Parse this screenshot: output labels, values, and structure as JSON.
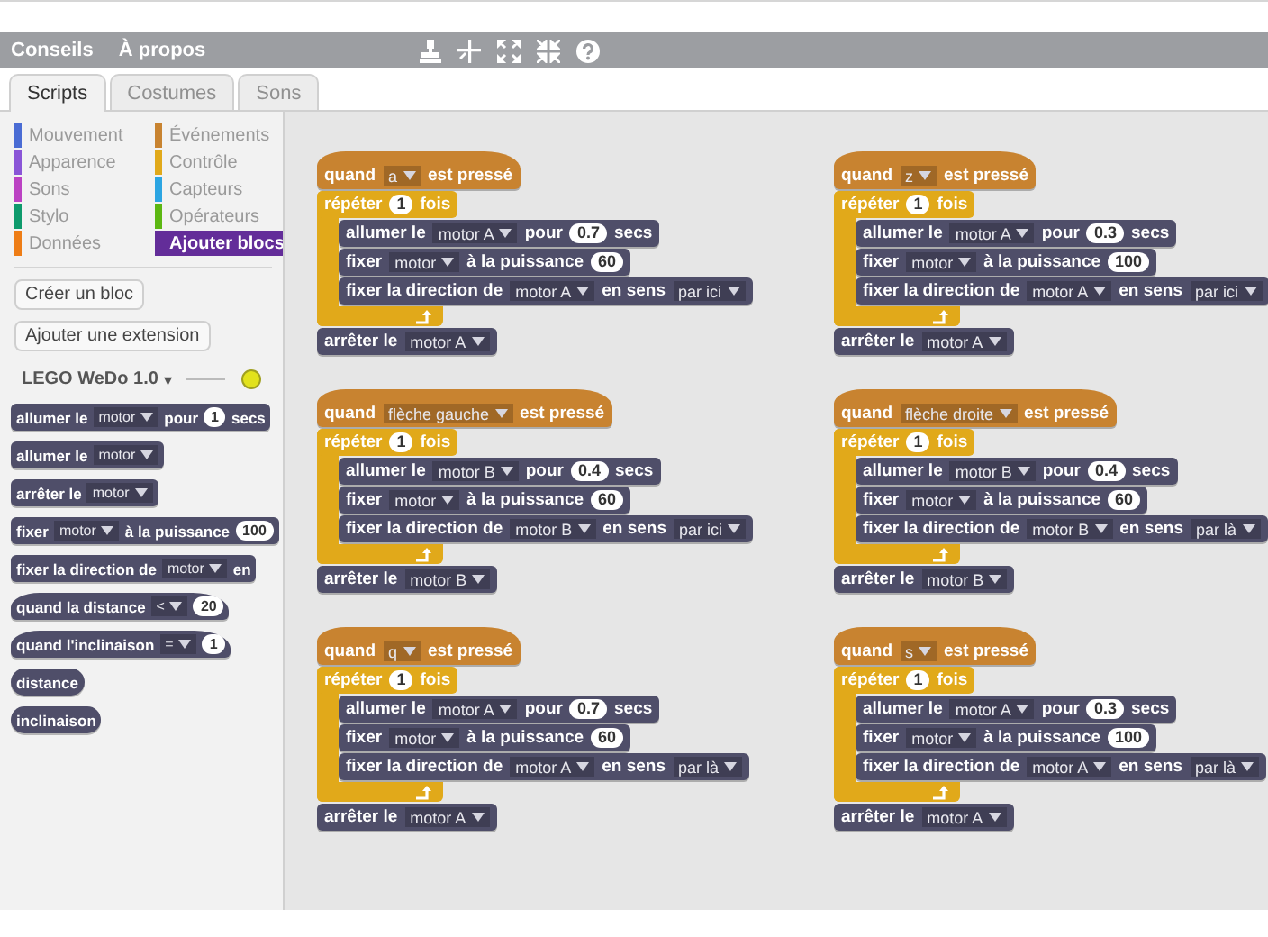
{
  "menu_bar": {
    "items": [
      "Conseils",
      "À propos"
    ]
  },
  "tabs": [
    {
      "label": "Scripts",
      "selected": true
    },
    {
      "label": "Costumes",
      "selected": false
    },
    {
      "label": "Sons",
      "selected": false
    }
  ],
  "palette": {
    "categories": [
      {
        "label": "Mouvement",
        "color": "#4a6cd4",
        "selected": false
      },
      {
        "label": "Événements",
        "color": "#c88330",
        "selected": false
      },
      {
        "label": "Apparence",
        "color": "#8a55d7",
        "selected": false
      },
      {
        "label": "Contrôle",
        "color": "#e1a91a",
        "selected": false
      },
      {
        "label": "Sons",
        "color": "#bb42c3",
        "selected": false
      },
      {
        "label": "Capteurs",
        "color": "#2ca5e2",
        "selected": false
      },
      {
        "label": "Stylo",
        "color": "#0e9a6c",
        "selected": false
      },
      {
        "label": "Opérateurs",
        "color": "#5cb712",
        "selected": false
      },
      {
        "label": "Données",
        "color": "#ee7d16",
        "selected": false
      },
      {
        "label": "Ajouter blocs",
        "color": "#632d99",
        "selected": true
      }
    ],
    "buttons": [
      "Créer un bloc",
      "Ajouter une extension"
    ],
    "extension": {
      "name": "LEGO WeDo 1.0",
      "menu_glyph": "▾",
      "ready": false
    },
    "blocks": [
      {
        "kind": "command",
        "color": "#4f4e69",
        "parts": [
          {
            "kind": "label",
            "text": "allumer le"
          },
          {
            "kind": "dropdown",
            "text": "motor"
          },
          {
            "kind": "label",
            "text": "pour"
          },
          {
            "kind": "number",
            "text": "1"
          },
          {
            "kind": "label",
            "text": "secs"
          }
        ]
      },
      {
        "kind": "command",
        "color": "#4f4e69",
        "parts": [
          {
            "kind": "label",
            "text": "allumer le"
          },
          {
            "kind": "dropdown",
            "text": "motor"
          }
        ]
      },
      {
        "kind": "command",
        "color": "#4f4e69",
        "parts": [
          {
            "kind": "label",
            "text": "arrêter le"
          },
          {
            "kind": "dropdown",
            "text": "motor"
          }
        ]
      },
      {
        "kind": "command",
        "color": "#4f4e69",
        "parts": [
          {
            "kind": "label",
            "text": "fixer"
          },
          {
            "kind": "dropdown",
            "text": "motor"
          },
          {
            "kind": "label",
            "text": "à la puissance"
          },
          {
            "kind": "number",
            "text": "100"
          }
        ]
      },
      {
        "kind": "command",
        "color": "#4f4e69",
        "parts": [
          {
            "kind": "label",
            "text": "fixer la direction de"
          },
          {
            "kind": "dropdown",
            "text": "motor"
          },
          {
            "kind": "label",
            "text": "en"
          }
        ]
      },
      {
        "kind": "hat",
        "color": "#4f4e69",
        "parts": [
          {
            "kind": "label",
            "text": "quand la distance"
          },
          {
            "kind": "dropdown",
            "text": "<"
          },
          {
            "kind": "number",
            "text": "20"
          }
        ]
      },
      {
        "kind": "hat",
        "color": "#4f4e69",
        "parts": [
          {
            "kind": "label",
            "text": "quand l'inclinaison"
          },
          {
            "kind": "dropdown",
            "text": "="
          },
          {
            "kind": "number",
            "text": "1"
          }
        ]
      },
      {
        "kind": "reporter",
        "color": "#4f4e69",
        "parts": [
          {
            "kind": "label",
            "text": "distance"
          }
        ]
      },
      {
        "kind": "reporter",
        "color": "#4f4e69",
        "parts": [
          {
            "kind": "label",
            "text": "inclinaison"
          }
        ]
      }
    ]
  },
  "scripts": [
    {
      "blocks": [
        {
          "kind": "hat",
          "color": "#c88330",
          "parts": [
            {
              "kind": "label",
              "text": "quand"
            },
            {
              "kind": "dropdown",
              "text": "a"
            },
            {
              "kind": "label",
              "text": "est pressé"
            }
          ]
        },
        {
          "kind": "repeat",
          "color": "#e1a91a",
          "parts": [
            {
              "kind": "label",
              "text": "répéter"
            },
            {
              "kind": "number",
              "text": "1"
            },
            {
              "kind": "label",
              "text": "fois"
            }
          ],
          "children": [
            {
              "kind": "command",
              "color": "#4f4e69",
              "parts": [
                {
                  "kind": "label",
                  "text": "allumer le"
                },
                {
                  "kind": "dropdown",
                  "text": "motor A"
                },
                {
                  "kind": "label",
                  "text": "pour"
                },
                {
                  "kind": "number",
                  "text": "0.7"
                },
                {
                  "kind": "label",
                  "text": "secs"
                }
              ]
            },
            {
              "kind": "command",
              "color": "#4f4e69",
              "parts": [
                {
                  "kind": "label",
                  "text": "fixer"
                },
                {
                  "kind": "dropdown",
                  "text": "motor"
                },
                {
                  "kind": "label",
                  "text": "à la puissance"
                },
                {
                  "kind": "number",
                  "text": "60"
                }
              ]
            },
            {
              "kind": "command",
              "color": "#4f4e69",
              "parts": [
                {
                  "kind": "label",
                  "text": "fixer la direction de"
                },
                {
                  "kind": "dropdown",
                  "text": "motor A"
                },
                {
                  "kind": "label",
                  "text": "en sens"
                },
                {
                  "kind": "dropdown",
                  "text": "par ici"
                }
              ]
            }
          ]
        },
        {
          "kind": "command",
          "color": "#4f4e69",
          "parts": [
            {
              "kind": "label",
              "text": "arrêter le"
            },
            {
              "kind": "dropdown",
              "text": "motor A"
            }
          ]
        }
      ]
    },
    {
      "blocks": [
        {
          "kind": "hat",
          "color": "#c88330",
          "parts": [
            {
              "kind": "label",
              "text": "quand"
            },
            {
              "kind": "dropdown",
              "text": "z"
            },
            {
              "kind": "label",
              "text": "est pressé"
            }
          ]
        },
        {
          "kind": "repeat",
          "color": "#e1a91a",
          "parts": [
            {
              "kind": "label",
              "text": "répéter"
            },
            {
              "kind": "number",
              "text": "1"
            },
            {
              "kind": "label",
              "text": "fois"
            }
          ],
          "children": [
            {
              "kind": "command",
              "color": "#4f4e69",
              "parts": [
                {
                  "kind": "label",
                  "text": "allumer le"
                },
                {
                  "kind": "dropdown",
                  "text": "motor A"
                },
                {
                  "kind": "label",
                  "text": "pour"
                },
                {
                  "kind": "number",
                  "text": "0.3"
                },
                {
                  "kind": "label",
                  "text": "secs"
                }
              ]
            },
            {
              "kind": "command",
              "color": "#4f4e69",
              "parts": [
                {
                  "kind": "label",
                  "text": "fixer"
                },
                {
                  "kind": "dropdown",
                  "text": "motor"
                },
                {
                  "kind": "label",
                  "text": "à la puissance"
                },
                {
                  "kind": "number",
                  "text": "100"
                }
              ]
            },
            {
              "kind": "command",
              "color": "#4f4e69",
              "parts": [
                {
                  "kind": "label",
                  "text": "fixer la direction de"
                },
                {
                  "kind": "dropdown",
                  "text": "motor A"
                },
                {
                  "kind": "label",
                  "text": "en sens"
                },
                {
                  "kind": "dropdown",
                  "text": "par ici"
                }
              ]
            }
          ]
        },
        {
          "kind": "command",
          "color": "#4f4e69",
          "parts": [
            {
              "kind": "label",
              "text": "arrêter le"
            },
            {
              "kind": "dropdown",
              "text": "motor A"
            }
          ]
        }
      ]
    },
    {
      "blocks": [
        {
          "kind": "hat",
          "color": "#c88330",
          "parts": [
            {
              "kind": "label",
              "text": "quand"
            },
            {
              "kind": "dropdown",
              "text": "flèche gauche"
            },
            {
              "kind": "label",
              "text": "est pressé"
            }
          ]
        },
        {
          "kind": "repeat",
          "color": "#e1a91a",
          "parts": [
            {
              "kind": "label",
              "text": "répéter"
            },
            {
              "kind": "number",
              "text": "1"
            },
            {
              "kind": "label",
              "text": "fois"
            }
          ],
          "children": [
            {
              "kind": "command",
              "color": "#4f4e69",
              "parts": [
                {
                  "kind": "label",
                  "text": "allumer le"
                },
                {
                  "kind": "dropdown",
                  "text": "motor B"
                },
                {
                  "kind": "label",
                  "text": "pour"
                },
                {
                  "kind": "number",
                  "text": "0.4"
                },
                {
                  "kind": "label",
                  "text": "secs"
                }
              ]
            },
            {
              "kind": "command",
              "color": "#4f4e69",
              "parts": [
                {
                  "kind": "label",
                  "text": "fixer"
                },
                {
                  "kind": "dropdown",
                  "text": "motor"
                },
                {
                  "kind": "label",
                  "text": "à la puissance"
                },
                {
                  "kind": "number",
                  "text": "60"
                }
              ]
            },
            {
              "kind": "command",
              "color": "#4f4e69",
              "parts": [
                {
                  "kind": "label",
                  "text": "fixer la direction de"
                },
                {
                  "kind": "dropdown",
                  "text": "motor B"
                },
                {
                  "kind": "label",
                  "text": "en sens"
                },
                {
                  "kind": "dropdown",
                  "text": "par ici"
                }
              ]
            }
          ]
        },
        {
          "kind": "command",
          "color": "#4f4e69",
          "parts": [
            {
              "kind": "label",
              "text": "arrêter le"
            },
            {
              "kind": "dropdown",
              "text": "motor B"
            }
          ]
        }
      ]
    },
    {
      "blocks": [
        {
          "kind": "hat",
          "color": "#c88330",
          "parts": [
            {
              "kind": "label",
              "text": "quand"
            },
            {
              "kind": "dropdown",
              "text": "flèche droite"
            },
            {
              "kind": "label",
              "text": "est pressé"
            }
          ]
        },
        {
          "kind": "repeat",
          "color": "#e1a91a",
          "parts": [
            {
              "kind": "label",
              "text": "répéter"
            },
            {
              "kind": "number",
              "text": "1"
            },
            {
              "kind": "label",
              "text": "fois"
            }
          ],
          "children": [
            {
              "kind": "command",
              "color": "#4f4e69",
              "parts": [
                {
                  "kind": "label",
                  "text": "allumer le"
                },
                {
                  "kind": "dropdown",
                  "text": "motor B"
                },
                {
                  "kind": "label",
                  "text": "pour"
                },
                {
                  "kind": "number",
                  "text": "0.4"
                },
                {
                  "kind": "label",
                  "text": "secs"
                }
              ]
            },
            {
              "kind": "command",
              "color": "#4f4e69",
              "parts": [
                {
                  "kind": "label",
                  "text": "fixer"
                },
                {
                  "kind": "dropdown",
                  "text": "motor"
                },
                {
                  "kind": "label",
                  "text": "à la puissance"
                },
                {
                  "kind": "number",
                  "text": "60"
                }
              ]
            },
            {
              "kind": "command",
              "color": "#4f4e69",
              "parts": [
                {
                  "kind": "label",
                  "text": "fixer la direction de"
                },
                {
                  "kind": "dropdown",
                  "text": "motor B"
                },
                {
                  "kind": "label",
                  "text": "en sens"
                },
                {
                  "kind": "dropdown",
                  "text": "par là"
                }
              ]
            }
          ]
        },
        {
          "kind": "command",
          "color": "#4f4e69",
          "parts": [
            {
              "kind": "label",
              "text": "arrêter le"
            },
            {
              "kind": "dropdown",
              "text": "motor B"
            }
          ]
        }
      ]
    },
    {
      "blocks": [
        {
          "kind": "hat",
          "color": "#c88330",
          "parts": [
            {
              "kind": "label",
              "text": "quand"
            },
            {
              "kind": "dropdown",
              "text": "q"
            },
            {
              "kind": "label",
              "text": "est pressé"
            }
          ]
        },
        {
          "kind": "repeat",
          "color": "#e1a91a",
          "parts": [
            {
              "kind": "label",
              "text": "répéter"
            },
            {
              "kind": "number",
              "text": "1"
            },
            {
              "kind": "label",
              "text": "fois"
            }
          ],
          "children": [
            {
              "kind": "command",
              "color": "#4f4e69",
              "parts": [
                {
                  "kind": "label",
                  "text": "allumer le"
                },
                {
                  "kind": "dropdown",
                  "text": "motor A"
                },
                {
                  "kind": "label",
                  "text": "pour"
                },
                {
                  "kind": "number",
                  "text": "0.7"
                },
                {
                  "kind": "label",
                  "text": "secs"
                }
              ]
            },
            {
              "kind": "command",
              "color": "#4f4e69",
              "parts": [
                {
                  "kind": "label",
                  "text": "fixer"
                },
                {
                  "kind": "dropdown",
                  "text": "motor"
                },
                {
                  "kind": "label",
                  "text": "à la puissance"
                },
                {
                  "kind": "number",
                  "text": "60"
                }
              ]
            },
            {
              "kind": "command",
              "color": "#4f4e69",
              "parts": [
                {
                  "kind": "label",
                  "text": "fixer la direction de"
                },
                {
                  "kind": "dropdown",
                  "text": "motor A"
                },
                {
                  "kind": "label",
                  "text": "en sens"
                },
                {
                  "kind": "dropdown",
                  "text": "par là"
                }
              ]
            }
          ]
        },
        {
          "kind": "command",
          "color": "#4f4e69",
          "parts": [
            {
              "kind": "label",
              "text": "arrêter le"
            },
            {
              "kind": "dropdown",
              "text": "motor A"
            }
          ]
        }
      ]
    },
    {
      "blocks": [
        {
          "kind": "hat",
          "color": "#c88330",
          "parts": [
            {
              "kind": "label",
              "text": "quand"
            },
            {
              "kind": "dropdown",
              "text": "s"
            },
            {
              "kind": "label",
              "text": "est pressé"
            }
          ]
        },
        {
          "kind": "repeat",
          "color": "#e1a91a",
          "parts": [
            {
              "kind": "label",
              "text": "répéter"
            },
            {
              "kind": "number",
              "text": "1"
            },
            {
              "kind": "label",
              "text": "fois"
            }
          ],
          "children": [
            {
              "kind": "command",
              "color": "#4f4e69",
              "parts": [
                {
                  "kind": "label",
                  "text": "allumer le"
                },
                {
                  "kind": "dropdown",
                  "text": "motor A"
                },
                {
                  "kind": "label",
                  "text": "pour"
                },
                {
                  "kind": "number",
                  "text": "0.3"
                },
                {
                  "kind": "label",
                  "text": "secs"
                }
              ]
            },
            {
              "kind": "command",
              "color": "#4f4e69",
              "parts": [
                {
                  "kind": "label",
                  "text": "fixer"
                },
                {
                  "kind": "dropdown",
                  "text": "motor"
                },
                {
                  "kind": "label",
                  "text": "à la puissance"
                },
                {
                  "kind": "number",
                  "text": "100"
                }
              ]
            },
            {
              "kind": "command",
              "color": "#4f4e69",
              "parts": [
                {
                  "kind": "label",
                  "text": "fixer la direction de"
                },
                {
                  "kind": "dropdown",
                  "text": "motor A"
                },
                {
                  "kind": "label",
                  "text": "en sens"
                },
                {
                  "kind": "dropdown",
                  "text": "par là"
                }
              ]
            }
          ]
        },
        {
          "kind": "command",
          "color": "#4f4e69",
          "parts": [
            {
              "kind": "label",
              "text": "arrêter le"
            },
            {
              "kind": "dropdown",
              "text": "motor A"
            }
          ]
        }
      ]
    }
  ]
}
